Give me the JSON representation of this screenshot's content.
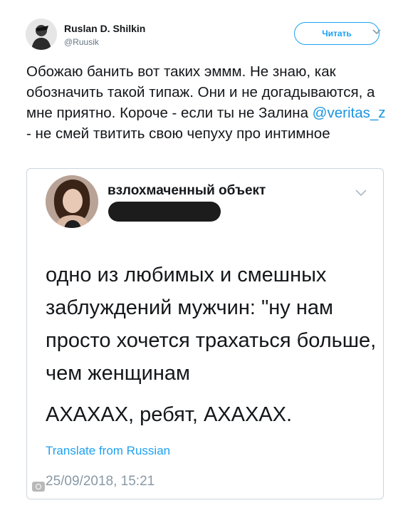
{
  "tweet": {
    "author_name": "Ruslan D. Shilkin",
    "author_handle": "@Ruusik",
    "follow_label": "Читать",
    "text_before_mention": "Обожаю банить вот таких эммм. Не знаю, как обозначить такой типаж. Они и не догадываются, а мне приятно. Короче - если ты не Залина ",
    "mention": "@veritas_z",
    "text_after_mention": " - не смей твитить свою чепуху про интимное"
  },
  "quoted_tweet": {
    "author_name": "взлохмаченный объект",
    "handle_redacted": true,
    "body": "одно из любимых и смешных заблуждений мужчин: \"ну нам просто хочется трахаться больше, чем женщинам",
    "last_line": "АХАХАХ, ребят, АХАХАХ.",
    "translate_label": "Translate from Russian",
    "timestamp": "25/09/2018, 15:21"
  },
  "colors": {
    "accent": "#1da1f2",
    "mention": "#1b95e0",
    "text": "#14171a",
    "muted": "#657786",
    "border": "#ccd6dd"
  },
  "icons": {
    "header_more": "chevron-down-icon",
    "quote_more": "chevron-down-icon",
    "corner": "camera-icon"
  }
}
